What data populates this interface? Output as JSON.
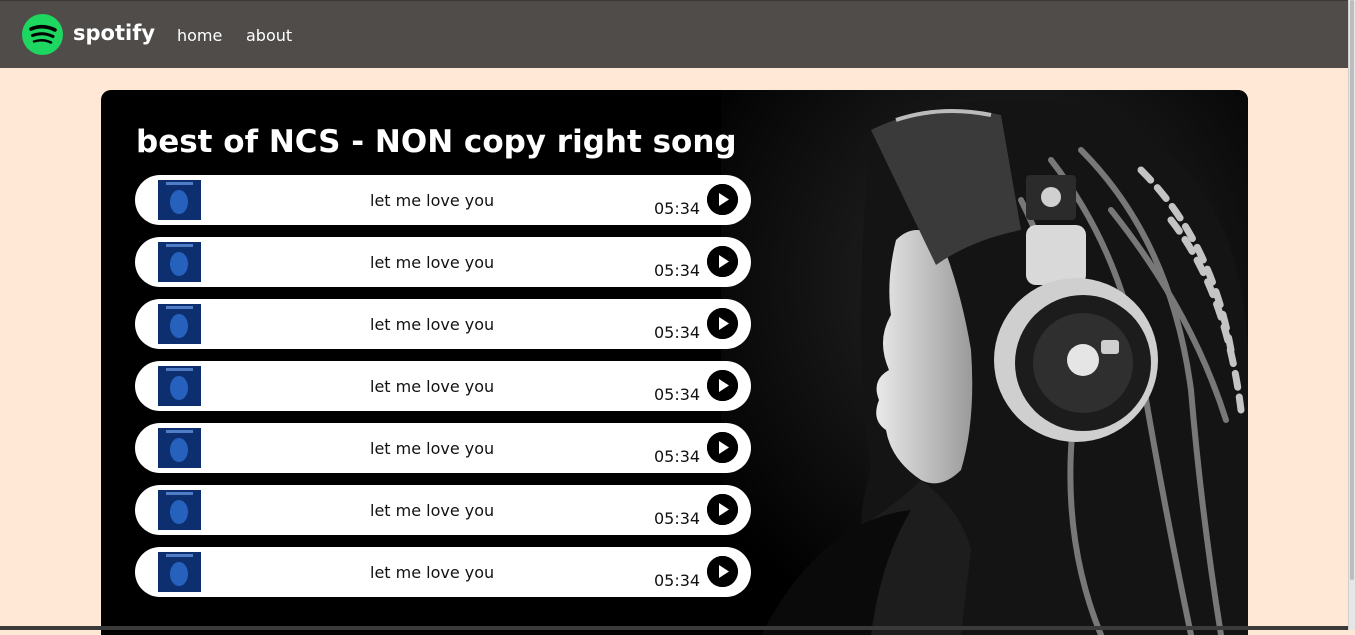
{
  "nav": {
    "brand": "spotify",
    "links": [
      "home",
      "about"
    ],
    "logo_icon": "spotify-logo-icon",
    "bg_color": "#4f4c4a",
    "logo_color": "#1ed760"
  },
  "page": {
    "bg_color": "#ffe9d6"
  },
  "playlist": {
    "title": "best of NCS - NON copy right song",
    "songs": [
      {
        "name": "let me love you",
        "duration": "05:34"
      },
      {
        "name": "let me love you",
        "duration": "05:34"
      },
      {
        "name": "let me love you",
        "duration": "05:34"
      },
      {
        "name": "let me love you",
        "duration": "05:34"
      },
      {
        "name": "let me love you",
        "duration": "05:34"
      },
      {
        "name": "let me love you",
        "duration": "05:34"
      },
      {
        "name": "let me love you",
        "duration": "05:34"
      }
    ],
    "song_icon": "play-icon",
    "hero_image": "woman-with-headphones-image"
  }
}
